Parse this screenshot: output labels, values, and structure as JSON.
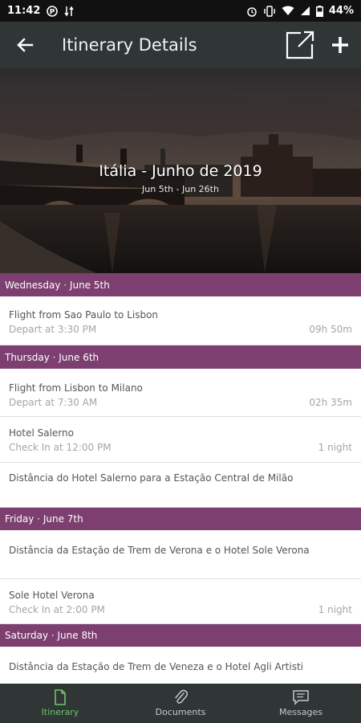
{
  "status_bar": {
    "time": "11:42",
    "battery": "44%"
  },
  "app_bar": {
    "title": "Itinerary Details",
    "back_icon": "arrow-left-icon",
    "share_icon": "open-external-icon",
    "add_icon": "plus-icon"
  },
  "hero": {
    "title": "Itália - Junho de 2019",
    "dates": "Jun 5th - Jun 26th"
  },
  "days": [
    {
      "header": "Wednesday · June 5th",
      "items": [
        {
          "name": "Flight from Sao Paulo to Lisbon",
          "sub": "Depart at 3:30 PM",
          "meta": "09h 50m"
        }
      ]
    },
    {
      "header": "Thursday · June 6th",
      "items": [
        {
          "name": "Flight from Lisbon to Milano",
          "sub": "Depart at 7:30 AM",
          "meta": "02h 35m"
        },
        {
          "name": "Hotel Salerno",
          "sub": "Check In at 12:00 PM",
          "meta": "1 night"
        },
        {
          "name": "Distância do Hotel Salerno para a Estação Central de Milão"
        }
      ]
    },
    {
      "header": "Friday · June 7th",
      "items": [
        {
          "name": "Distância da Estação de Trem de Verona e o Hotel Sole Verona"
        },
        {
          "name": "Sole Hotel Verona",
          "sub": "Check In at 2:00 PM",
          "meta": "1 night"
        }
      ]
    },
    {
      "header": "Saturday · June 8th",
      "items": [
        {
          "name": "Distância da Estação de Trem de Veneza e o Hotel Agli Artisti"
        }
      ]
    }
  ],
  "bottom_nav": {
    "items": [
      {
        "label": "Itinerary",
        "icon": "document-icon",
        "active": true
      },
      {
        "label": "Documents",
        "icon": "paperclip-icon",
        "active": false
      },
      {
        "label": "Messages",
        "icon": "message-icon",
        "active": false
      }
    ]
  },
  "colors": {
    "day_header": "#7c3f70",
    "app_bar": "#303535",
    "active_nav": "#6ec66e"
  }
}
